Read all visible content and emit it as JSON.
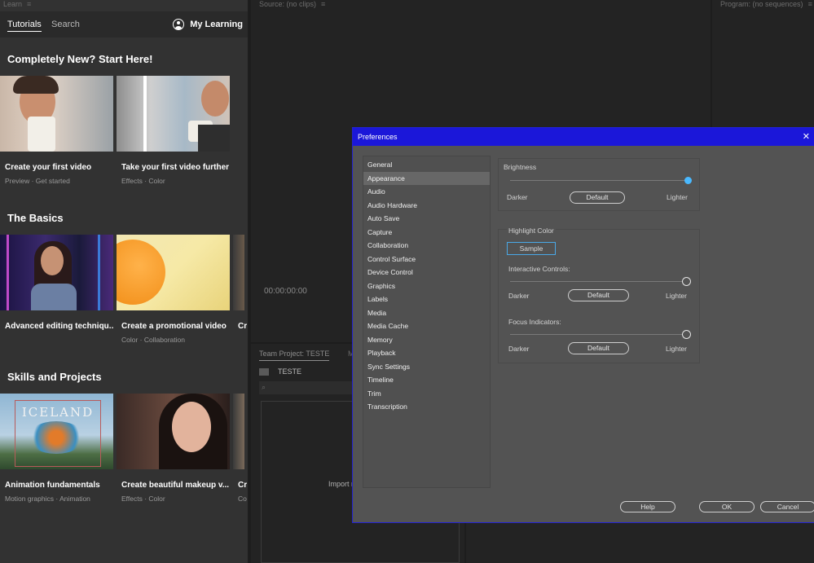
{
  "learn_panel": {
    "tab_title": "Learn",
    "tabs": [
      "Tutorials",
      "Search"
    ],
    "my_learning": "My Learning",
    "sections": [
      {
        "title": "Completely New? Start Here!",
        "cards": [
          {
            "title": "Create your first video",
            "tags": [
              "Preview",
              "Get started"
            ]
          },
          {
            "title": "Take your first video further",
            "tags": [
              "Effects",
              "Color"
            ]
          }
        ]
      },
      {
        "title": "The Basics",
        "cards": [
          {
            "title": "Advanced editing techniqu...",
            "tags": []
          },
          {
            "title": "Create a promotional video",
            "tags": [
              "Color",
              "Collaboration"
            ]
          },
          {
            "title": "Cr",
            "tags": []
          }
        ]
      },
      {
        "title": "Skills and Projects",
        "cards": [
          {
            "title": "Animation fundamentals",
            "tags": [
              "Motion graphics",
              "Animation"
            ]
          },
          {
            "title": "Create beautiful makeup v...",
            "tags": [
              "Effects",
              "Color"
            ]
          },
          {
            "title": "Cr",
            "tags": [
              "Co"
            ]
          }
        ]
      }
    ],
    "thumbnail_text": "ICELAND"
  },
  "source_panel": {
    "tab_title": "Source: (no clips)",
    "timecode": "00:00:00:00"
  },
  "program_panel": {
    "tab_title": "Program: (no sequences)"
  },
  "project_panel": {
    "tab_title": "Team Project: TESTE",
    "tab2": "M",
    "item": "TESTE",
    "import_text": "Import r"
  },
  "dialog": {
    "title": "Preferences",
    "categories": [
      "General",
      "Appearance",
      "Audio",
      "Audio Hardware",
      "Auto Save",
      "Capture",
      "Collaboration",
      "Control Surface",
      "Device Control",
      "Graphics",
      "Labels",
      "Media",
      "Media Cache",
      "Memory",
      "Playback",
      "Sync Settings",
      "Timeline",
      "Trim",
      "Transcription"
    ],
    "selected_category": "Appearance",
    "brightness": {
      "label": "Brightness",
      "darker": "Darker",
      "lighter": "Lighter",
      "default_btn": "Default",
      "value": 1.0
    },
    "highlight": {
      "label": "Highlight Color",
      "sample_label": "Sample",
      "interactive_label": "Interactive Controls:",
      "interactive_value": 1.0,
      "focus_label": "Focus Indicators:",
      "focus_value": 1.0,
      "darker": "Darker",
      "lighter": "Lighter",
      "default_btn": "Default"
    },
    "buttons": {
      "help": "Help",
      "ok": "OK",
      "cancel": "Cancel"
    }
  },
  "colors": {
    "title_bar": "#1b17d9",
    "slider_blue": "#4ab9ff",
    "sample_border": "#4aa9e8"
  }
}
